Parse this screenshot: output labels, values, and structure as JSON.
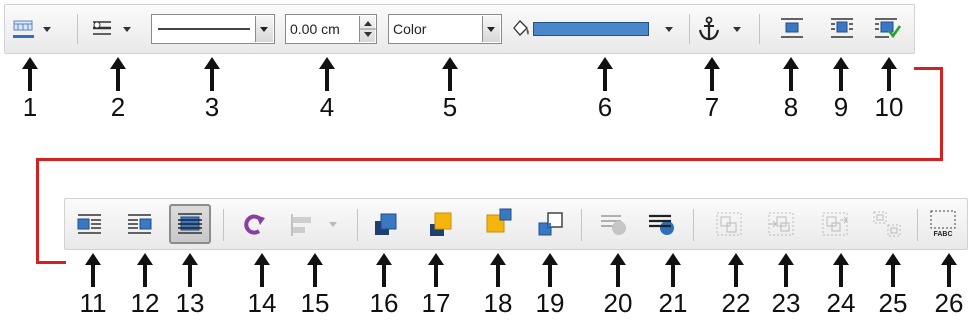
{
  "toolbar_row1": {
    "line_width_value": "0.00 cm",
    "area_style": "Color",
    "fill_color": "#4a86c8"
  },
  "toolbar_row2": {},
  "callouts_row1": [
    "1",
    "2",
    "3",
    "4",
    "5",
    "6",
    "7",
    "8",
    "9",
    "10"
  ],
  "callouts_row2": [
    "11",
    "12",
    "13",
    "14",
    "15",
    "16",
    "17",
    "18",
    "19",
    "20",
    "21",
    "22",
    "23",
    "24",
    "25",
    "26"
  ],
  "icons": {
    "1": "border-style-icon",
    "2": "line-style-icon",
    "3": "line-combo",
    "4": "line-width-spin",
    "5": "area-style-combo",
    "6": "fill-color-icon",
    "7": "anchor-icon",
    "8": "wrap-off-icon",
    "9": "page-wrap-icon",
    "10": "optimal-wrap-icon",
    "11": "wrap-left-icon",
    "12": "wrap-right-icon",
    "13": "wrap-through-icon",
    "14": "rotate-icon",
    "15": "alignment-icon",
    "16": "bring-to-front-icon",
    "17": "send-to-back-icon",
    "18": "bring-forward-icon",
    "19": "send-backward-icon",
    "20": "to-foreground-icon",
    "21": "to-background-icon",
    "22": "group-icon",
    "23": "enter-group-icon",
    "24": "exit-group-icon",
    "25": "ungroup-icon",
    "26": "insert-caption-icon"
  },
  "colors": {
    "callout_line": "#d42020",
    "accent": "#2f6fbd"
  }
}
